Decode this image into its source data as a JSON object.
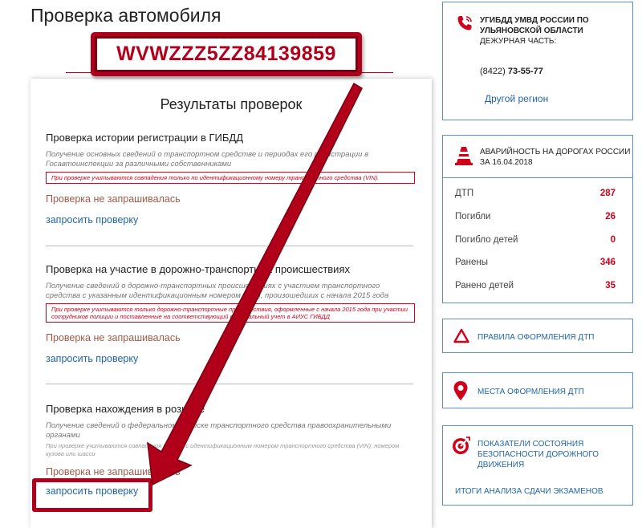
{
  "page": {
    "title": "Проверка автомобиля"
  },
  "vin": "WVWZZZ5ZZ84139859",
  "results": {
    "title": "Результаты проверок",
    "checks": [
      {
        "title": "Проверка истории регистрации в ГИБДД",
        "desc": "Получение основных сведений о транспортном средстве и периодах его регистрации в Госавтоинспекции за различными собственниками",
        "note": "При проверке учитываются совпадения только по идентификационному номеру транспортного средства (VIN).",
        "status": "Проверка не запрашивалась",
        "link": "запросить проверку"
      },
      {
        "title": "Проверка на участие в дорожно-транспортных происшествиях",
        "desc": "Получение сведений о дорожно-транспортных происшествиях с участием транспортного средства с указанным идентификационным номером (VIN), произошедших с начала 2015 года",
        "note": "При проверке учитываются только дорожно-транспортные происшествия, оформленные с начала 2015 года при участии сотрудников полиции и поставленные на соответствующий федеральный учет в АИУС ГИБДД",
        "status": "Проверка не запрашивалась",
        "link": "запросить проверку"
      },
      {
        "title": "Проверка нахождения в розыске",
        "desc": "Получение сведений о федеральном розыске транспортного средства правоохранительными органами",
        "note": "При проверке учитываются совпадения только с идентификационным номером транспортного средства (VIN), номером кузова или шасси",
        "status": "Проверка не запрашивалась",
        "link": "запросить проверку"
      }
    ]
  },
  "contact": {
    "title": "УГИБДД УМВД РОССИИ ПО УЛЬЯНОВСКОЙ ОБЛАСТИ",
    "subtitle": "ДЕЖУРНАЯ ЧАСТЬ:",
    "phone_code": "(8422)",
    "phone_number": "73-55-77",
    "region_link": "Другой регион"
  },
  "accidents": {
    "title": "АВАРИЙНОСТЬ НА ДОРОГАХ РОССИИ ЗА 16.04.2018",
    "rows": [
      {
        "label": "ДТП",
        "value": "287"
      },
      {
        "label": "Погибли",
        "value": "26"
      },
      {
        "label": "Погибло детей",
        "value": "0"
      },
      {
        "label": "Ранены",
        "value": "346"
      },
      {
        "label": "Ранено детей",
        "value": "35"
      }
    ]
  },
  "links": {
    "rules": "ПРАВИЛА ОФОРМЛЕНИЯ ДТП",
    "places": "МЕСТА ОФОРМЛЕНИЯ ДТП",
    "indicators": "ПОКАЗАТЕЛИ СОСТОЯНИЯ БЕЗОПАСНОСТИ ДОРОЖНОГО ДВИЖЕНИЯ",
    "exams": "ИТОГИ АНАЛИЗА СДАЧИ ЭКЗАМЕНОВ"
  },
  "colors": {
    "accent": "#b0001b",
    "link": "#2166a8",
    "border": "#5a8fc3",
    "alert": "#d0021b"
  },
  "icons": [
    "phone-icon",
    "traffic-cone-icon",
    "warning-triangle-icon",
    "map-pin-icon",
    "target-icon",
    "arrow-annotation"
  ]
}
